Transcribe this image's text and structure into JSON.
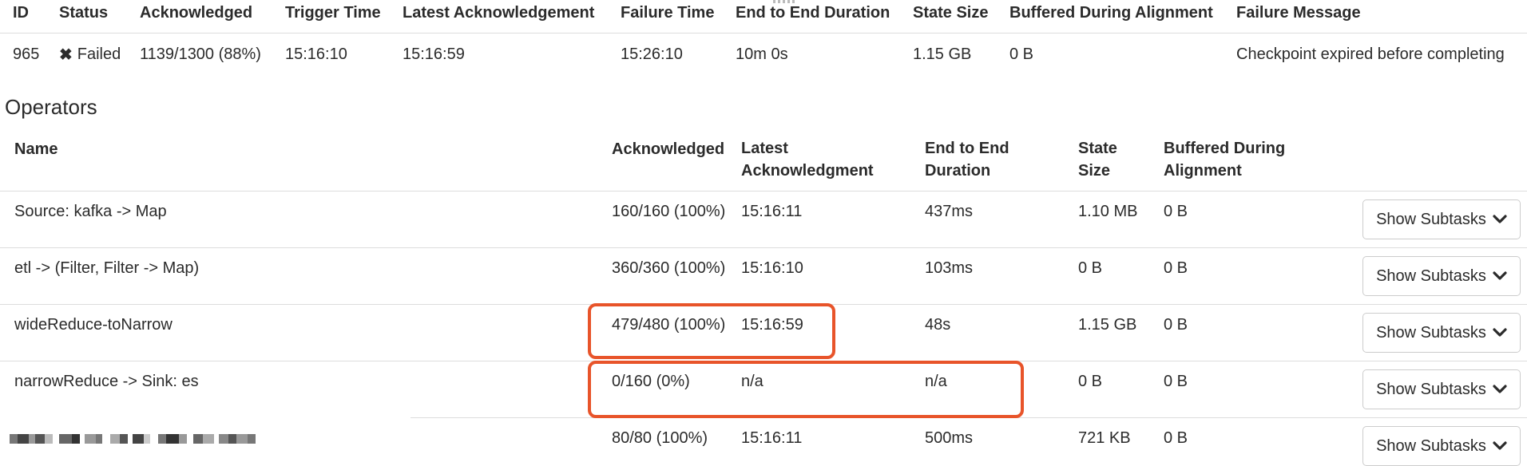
{
  "checkpoint": {
    "headers": {
      "id": "ID",
      "status": "Status",
      "acknowledged": "Acknowledged",
      "trigger_time": "Trigger Time",
      "latest_ack": "Latest Acknowledgement",
      "failure_time": "Failure Time",
      "e2e_duration": "End to End Duration",
      "state_size": "State Size",
      "buffered": "Buffered During Alignment",
      "failure_message": "Failure Message"
    },
    "row": {
      "id": "965",
      "status": "Failed",
      "acknowledged": "1139/1300 (88%)",
      "trigger_time": "15:16:10",
      "latest_ack": "15:16:59",
      "failure_time": "15:26:10",
      "e2e_duration": "10m 0s",
      "state_size": "1.15 GB",
      "buffered": "0 B",
      "failure_message": "Checkpoint expired before completing"
    }
  },
  "operators": {
    "title": "Operators",
    "headers": {
      "name": "Name",
      "acknowledged": "Acknowledged",
      "latest_ack_1": "Latest",
      "latest_ack_2": "Acknowledgment",
      "e2e_1": "End to End",
      "e2e_2": "Duration",
      "state_1": "State",
      "state_2": "Size",
      "buffered_1": "Buffered During",
      "buffered_2": "Alignment"
    },
    "rows": [
      {
        "name": "Source: kafka -> Map",
        "acknowledged": "160/160 (100%)",
        "latest_ack": "15:16:11",
        "e2e": "437ms",
        "state_size": "1.10 MB",
        "buffered": "0 B",
        "button": "Show Subtasks"
      },
      {
        "name": "etl -> (Filter, Filter -> Map)",
        "acknowledged": "360/360 (100%)",
        "latest_ack": "15:16:10",
        "e2e": "103ms",
        "state_size": "0 B",
        "buffered": "0 B",
        "button": "Show Subtasks"
      },
      {
        "name": "wideReduce-toNarrow",
        "acknowledged": "479/480 (100%)",
        "latest_ack": "15:16:59",
        "e2e": "48s",
        "state_size": "1.15 GB",
        "buffered": "0 B",
        "button": "Show Subtasks"
      },
      {
        "name": "narrowReduce -> Sink: es",
        "acknowledged": "0/160 (0%)",
        "latest_ack": "n/a",
        "e2e": "n/a",
        "state_size": "0 B",
        "buffered": "0 B",
        "button": "Show Subtasks"
      },
      {
        "name": "",
        "acknowledged": "80/80 (100%)",
        "latest_ack": "15:16:11",
        "e2e": "500ms",
        "state_size": "721 KB",
        "buffered": "0 B",
        "button": "Show Subtasks"
      }
    ]
  },
  "icons": {
    "status_failed": "close-icon",
    "button_chevron": "chevron-down-icon"
  },
  "colors": {
    "highlight": "#e8542a",
    "text": "#2b2b2b",
    "border": "#dddddd"
  }
}
